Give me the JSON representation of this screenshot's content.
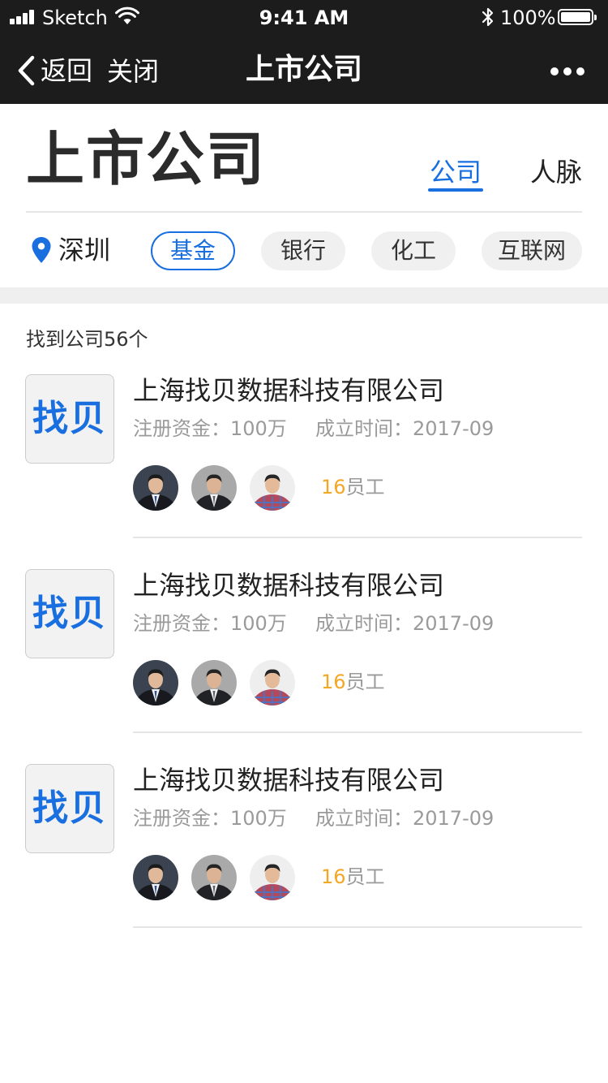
{
  "status_bar": {
    "carrier": "Sketch",
    "time": "9:41 AM",
    "battery": "100%"
  },
  "nav": {
    "back_label": "返回",
    "close_label": "关闭",
    "title": "上市公司"
  },
  "header": {
    "heading": "上市公司",
    "tabs": [
      {
        "label": "公司",
        "active": true
      },
      {
        "label": "人脉",
        "active": false
      }
    ]
  },
  "filters": {
    "location": "深圳",
    "chips": [
      {
        "label": "基金",
        "active": true
      },
      {
        "label": "银行",
        "active": false
      },
      {
        "label": "化工",
        "active": false
      },
      {
        "label": "互联网",
        "active": false
      }
    ]
  },
  "results": {
    "count_text": "找到公司56个",
    "items": [
      {
        "logo_text": "找贝",
        "name": "上海找贝数据科技有限公司",
        "capital": "注册资金：100万",
        "founded": "成立时间：2017-09",
        "staff_count": "16",
        "staff_suffix": "员工"
      },
      {
        "logo_text": "找贝",
        "name": "上海找贝数据科技有限公司",
        "capital": "注册资金：100万",
        "founded": "成立时间：2017-09",
        "staff_count": "16",
        "staff_suffix": "员工"
      },
      {
        "logo_text": "找贝",
        "name": "上海找贝数据科技有限公司",
        "capital": "注册资金：100万",
        "founded": "成立时间：2017-09",
        "staff_count": "16",
        "staff_suffix": "员工"
      }
    ]
  },
  "icons": {
    "back": "chevron-left-icon",
    "more": "more-dots-icon",
    "location": "location-pin-icon",
    "signal": "signal-icon",
    "wifi": "wifi-icon",
    "bluetooth": "bluetooth-icon",
    "battery": "battery-icon"
  },
  "colors": {
    "accent": "#1a6fe0",
    "nav_background": "#1c1c1c",
    "staff_count": "#f5a623",
    "chip_background": "#f0f0f0"
  }
}
